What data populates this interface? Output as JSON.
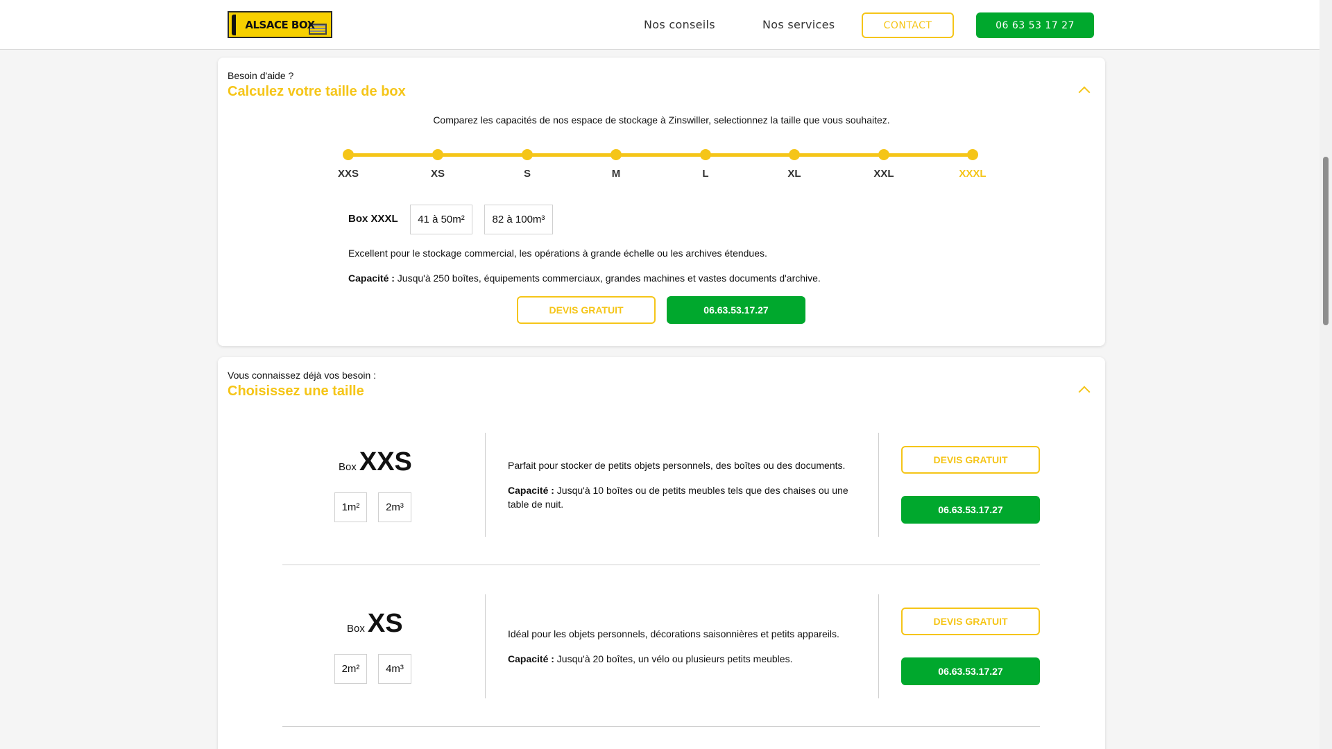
{
  "header": {
    "logo_text": "ALSACE BOX",
    "nav": [
      "Nos conseils",
      "Nos services"
    ],
    "contact_label": "CONTACT",
    "phone_label": "06 63 53 17 27"
  },
  "calculator": {
    "pre_title": "Besoin d'aide ?",
    "title": "Calculez votre taille de box",
    "intro": "Comparez les capacités de nos espace de stockage à Zinswiller, selectionnez la taille que vous souhaitez.",
    "sizes": [
      "XXS",
      "XS",
      "S",
      "M",
      "L",
      "XL",
      "XXL",
      "XXXL"
    ],
    "selected_size": "XXXL",
    "selected_box_label": "Box XXXL",
    "area": "41 à 50m²",
    "volume": "82 à 100m³",
    "description": "Excellent pour le stockage commercial, les opérations à grande échelle ou les archives étendues.",
    "capacity_label": "Capacité :",
    "capacity_text": " Jusqu'à 250 boîtes, équipements commerciaux, grandes machines et vastes documents d'archive.",
    "quote_button": "DEVIS GRATUIT",
    "phone_button": "06.63.53.17.27"
  },
  "choose": {
    "pre_title": "Vous connaissez déjà vos besoin :",
    "title": "Choisissez une taille",
    "boxes": [
      {
        "prefix": "Box",
        "size": "XXS",
        "area": "1m²",
        "volume": "2m³",
        "description": "Parfait pour stocker de petits objets personnels, des boîtes ou des documents.",
        "capacity_label": "Capacité :",
        "capacity_text": " Jusqu'à 10 boîtes ou de petits meubles tels que des chaises ou une table de nuit.",
        "quote_button": "DEVIS GRATUIT",
        "phone_button": "06.63.53.17.27"
      },
      {
        "prefix": "Box",
        "size": "XS",
        "area": "2m²",
        "volume": "4m³",
        "description": "Idéal pour les objets personnels, décorations saisonnières et petits appareils.",
        "capacity_label": "Capacité :",
        "capacity_text": " Jusqu'à 20 boîtes, un vélo ou plusieurs petits meubles.",
        "quote_button": "DEVIS GRATUIT",
        "phone_button": "06.63.53.17.27"
      }
    ]
  },
  "colors": {
    "accent_yellow": "#f5c518",
    "accent_green": "#00a82d"
  }
}
